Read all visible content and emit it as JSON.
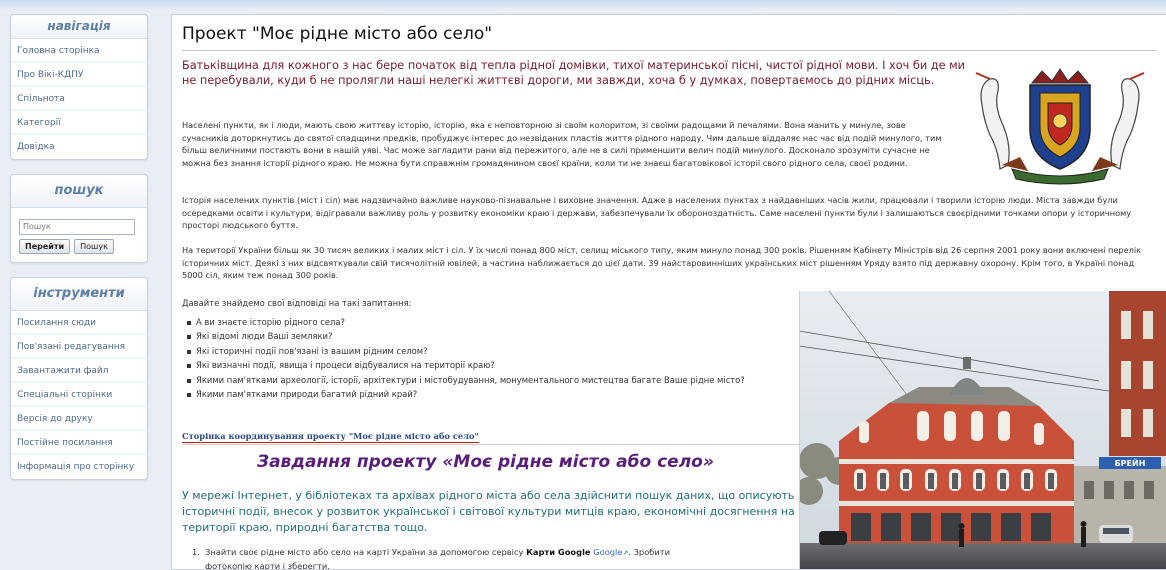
{
  "sidebar": {
    "navigation": {
      "title": "навігація",
      "items": [
        "Головна сторінка",
        "Про Вікі-КДПУ",
        "Спільнота",
        "Категорії",
        "Довідка"
      ]
    },
    "search": {
      "title": "пошук",
      "placeholder": "Пошук",
      "go_label": "Перейти",
      "search_label": "Пошук"
    },
    "tools": {
      "title": "інструменти",
      "items": [
        "Посилання сюди",
        "Пов'язані редагування",
        "Завантажити файл",
        "Спеціальні сторінки",
        "Версія до друку",
        "Постійне посилання",
        "Інформація про сторінку"
      ]
    }
  },
  "page": {
    "title": "Проект \"Моє рідне місто або село\"",
    "intro": "Батьківщина для кожного з нас бере початок від тепла рідної домівки, тихої материнської пісні, чистої рідної мови. І хоч би де ми не перебували, куди б не пролягли наші нелегкі життєві дороги, ми завжди, хоча б у думках, повертаємось до рідних місць.",
    "paragraphs": [
      "Населені пункти, як і люди, мають свою життєву історію, історію, яка є неповторною зі своїм колоритом, зі своїми радощами й печалями. Вона манить у минуле, зове сучасників доторкнутись до святої спадщини предків, пробуджує інтерес до незвіданих пластів життя рідного народу. Чим дальше віддаляє нас час від подій минулого, тим більш величними постають вони в нашій уяві. Час може загладити рани від пережитого, але не в силі применшити велич подій минулого. Досконало зрозуміти сучасне не можна без знання історії рідного краю. Не можна бути справжнім громадянином своєї країни, коли ти не знаєш багатовікової історії свого рідного села, своєї родини.",
      "Історія населених пунктів (міст і сіл) має надзвичайно важливе науково-пізнавальне і виховне значення. Адже в населених пунктах з найдавніших часів жили, працювали і творили історію люди. Міста завжди були осередками освіти і культури, відігравали важливу роль у розвитку економіки краю і держави, забезпечували їх обороноздатність. Саме населені пункти були і залишаються своєрідними точками опори у історичному просторі людського буття.",
      "На території України більш як 30 тисяч великих і малих міст і сіл. У їх числі понад 800 міст, селищ міського типу, яким минуло понад 300 років. Рішенням Кабінету Міністрів від 26 серпня 2001 року вони включені перелік історичних міст. Деякі з них відсвяткували свій тисячолітній ювілей, а частина наближається до цієї дати. 39 найстаровинніших українських міст рішенням Уряду взято під державну охорону. Крім того, в Україні понад 5000 сіл, яким теж понад 300 років."
    ],
    "questions_intro": "Давайте знайдемо свої відповіді на такі запитання:",
    "questions": [
      "А ви знаєте історію рідного села?",
      "Які відомі люди Ваші земляки?",
      "Які історичні події пов'язані із вашим рідним селом?",
      "Які визначні події, явища і процеси відбувалися на території краю?",
      "Якими пам'ятками археології, історії, архітектури і містобудування, монументального мистецтва багате Ваше рідне місто?",
      "Якими пам'ятками природи багатий рідний край?"
    ],
    "coordination_link": "Сторінка координування проекту \"Моє рідне місто або село\"",
    "tasks_title": "Завдання проекту «Моє рідне місто або село»",
    "tasks_intro": "У мережі Інтернет, у бібліотеках та архівах рідного міста або села здійснити пошук даних, що описують історичні події, внесок у розвиток української і світової культури митців краю, економічні досягнення на території краю, природні багатства тощо.",
    "task1": {
      "number": "1.",
      "before": "Знайти своє рідне місто або село на карті України за допомогою сервісу",
      "service": "Карти Google",
      "link": "Google",
      "after": ". Зробити",
      "line2": "фотокопію карти і зберегти."
    },
    "photo_sign": "БРЕЙН"
  },
  "colors": {
    "intro_text": "#7a1a2e",
    "tasks_title": "#5a1e7a",
    "tasks_intro": "#1f6d77",
    "link": "#2b4a8b",
    "link_underline": "#cc1a1a",
    "sidebar_link": "#4d6a8d",
    "sidebar_heading": "#5d7fa8"
  }
}
